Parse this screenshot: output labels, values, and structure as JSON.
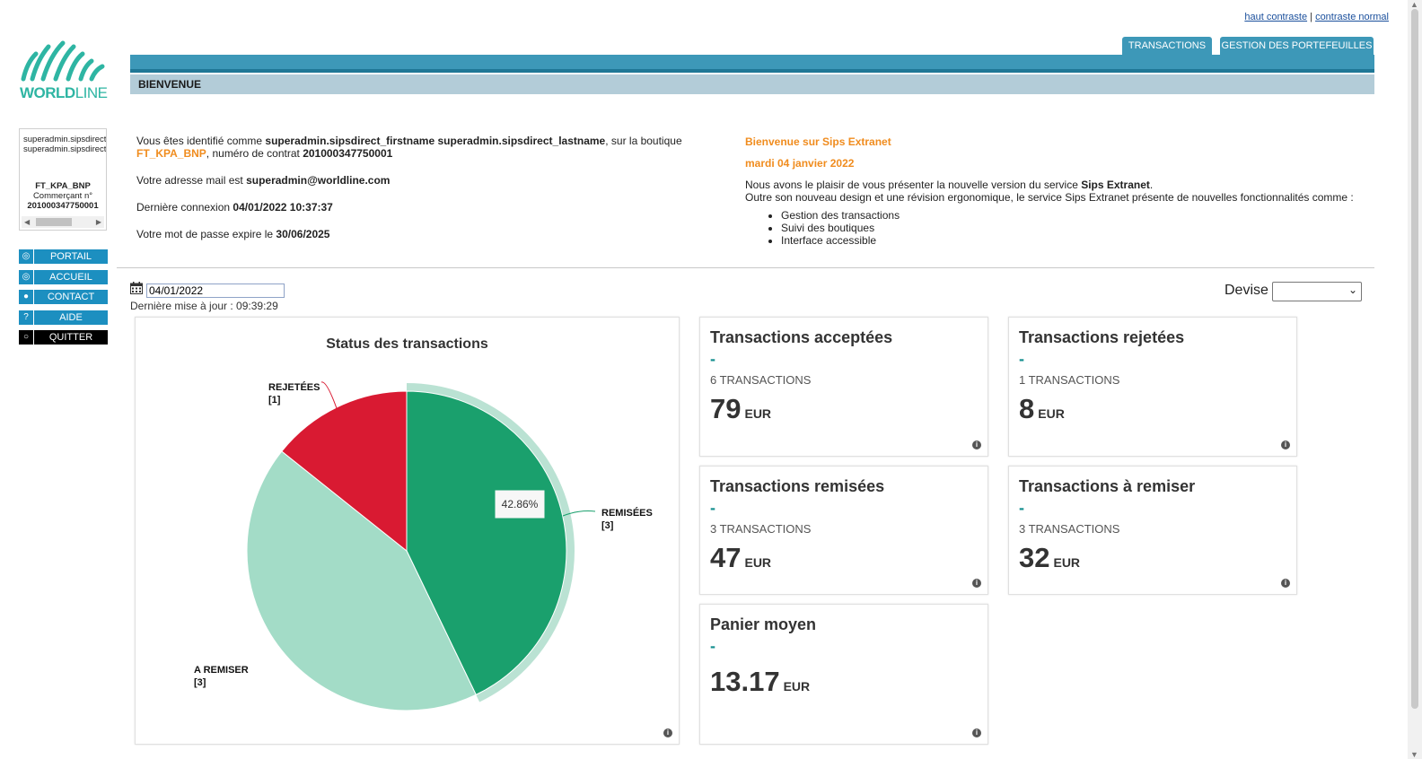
{
  "contrast": {
    "high": "haut contraste",
    "separator": "|",
    "normal": "contraste normal"
  },
  "logo": {
    "text_bold": "WORLD",
    "text_light": "LINE"
  },
  "tabs": [
    {
      "label": "TRANSACTIONS"
    },
    {
      "label": "GESTION DES PORTEFEUILLES"
    }
  ],
  "page_title": "BIENVENUE",
  "merchant": {
    "user_line1": "superadmin.sipsdirect_firstname",
    "user_line2": "superadmin.sipsdirect_lastname",
    "shop": "FT_KPA_BNP",
    "contract_label": "Commerçant n°",
    "contract": "201000347750001"
  },
  "nav": [
    {
      "label": "PORTAIL",
      "icon": "◎"
    },
    {
      "label": "ACCUEIL",
      "icon": "◎"
    },
    {
      "label": "CONTACT",
      "icon": "●"
    },
    {
      "label": "AIDE",
      "icon": "?"
    },
    {
      "label": "QUITTER",
      "icon": "○"
    }
  ],
  "ident": {
    "intro": "Vous êtes identifié comme ",
    "username": "superadmin.sipsdirect_firstname superadmin.sipsdirect_lastname",
    "shop_prefix": ", sur la boutique",
    "shop": "FT_KPA_BNP",
    "contract_prefix": ", numéro de contrat ",
    "contract": "201000347750001",
    "mail_prefix": "Votre adresse mail est ",
    "mail": "superadmin@worldline.com",
    "lastlogin_prefix": "Dernière connexion ",
    "lastlogin": "04/01/2022 10:37:37",
    "pwd_prefix": "Votre mot de passe expire le ",
    "pwd_expiry": "30/06/2025"
  },
  "news": {
    "title": "Bienvenue sur Sips Extranet",
    "date": "mardi 04 janvier 2022",
    "line1_prefix": "Nous avons le plaisir de vous présenter la nouvelle version du service ",
    "line1_bold": "Sips Extranet",
    "line1_suffix": ".",
    "line2": "Outre son nouveau design et une révision ergonomique, le service Sips Extranet présente de nouvelles fonctionnalités comme :",
    "features": [
      "Gestion des transactions",
      "Suivi des boutiques",
      "Interface accessible"
    ]
  },
  "filters": {
    "date": "04/01/2022",
    "last_update": "Dernière mise à jour : 09:39:29",
    "devise_label": "Devise",
    "devise_value": ""
  },
  "cards": [
    {
      "title": "Transactions acceptées",
      "dash": "-",
      "count": "6 TRANSACTIONS",
      "amount": "79",
      "currency": "EUR"
    },
    {
      "title": "Transactions rejetées",
      "dash": "-",
      "count": "1 TRANSACTIONS",
      "amount": "8",
      "currency": "EUR"
    },
    {
      "title": "Transactions remisées",
      "dash": "-",
      "count": "3 TRANSACTIONS",
      "amount": "47",
      "currency": "EUR"
    },
    {
      "title": "Transactions à remiser",
      "dash": "-",
      "count": "3 TRANSACTIONS",
      "amount": "32",
      "currency": "EUR"
    },
    {
      "title": "Panier moyen",
      "dash": "-",
      "count": "",
      "amount": "13.17",
      "currency": "EUR"
    }
  ],
  "colors": {
    "remisees": "#1aa06d",
    "a_remiser": "#a3dcc7",
    "rejetees": "#d91a32",
    "accent": "#3d98b8"
  },
  "chart_data": {
    "type": "pie",
    "title": "Status des transactions",
    "slices": [
      {
        "label": "REMISÉES",
        "count_label": "[3]",
        "value": 3,
        "color": "#1aa06d"
      },
      {
        "label": "A REMISER",
        "count_label": "[3]",
        "value": 3,
        "color": "#a3dcc7"
      },
      {
        "label": "REJETÉES",
        "count_label": "[1]",
        "value": 1,
        "color": "#d91a32"
      }
    ],
    "highlighted_slice": "REMISÉES",
    "tooltip": "42.86%"
  }
}
